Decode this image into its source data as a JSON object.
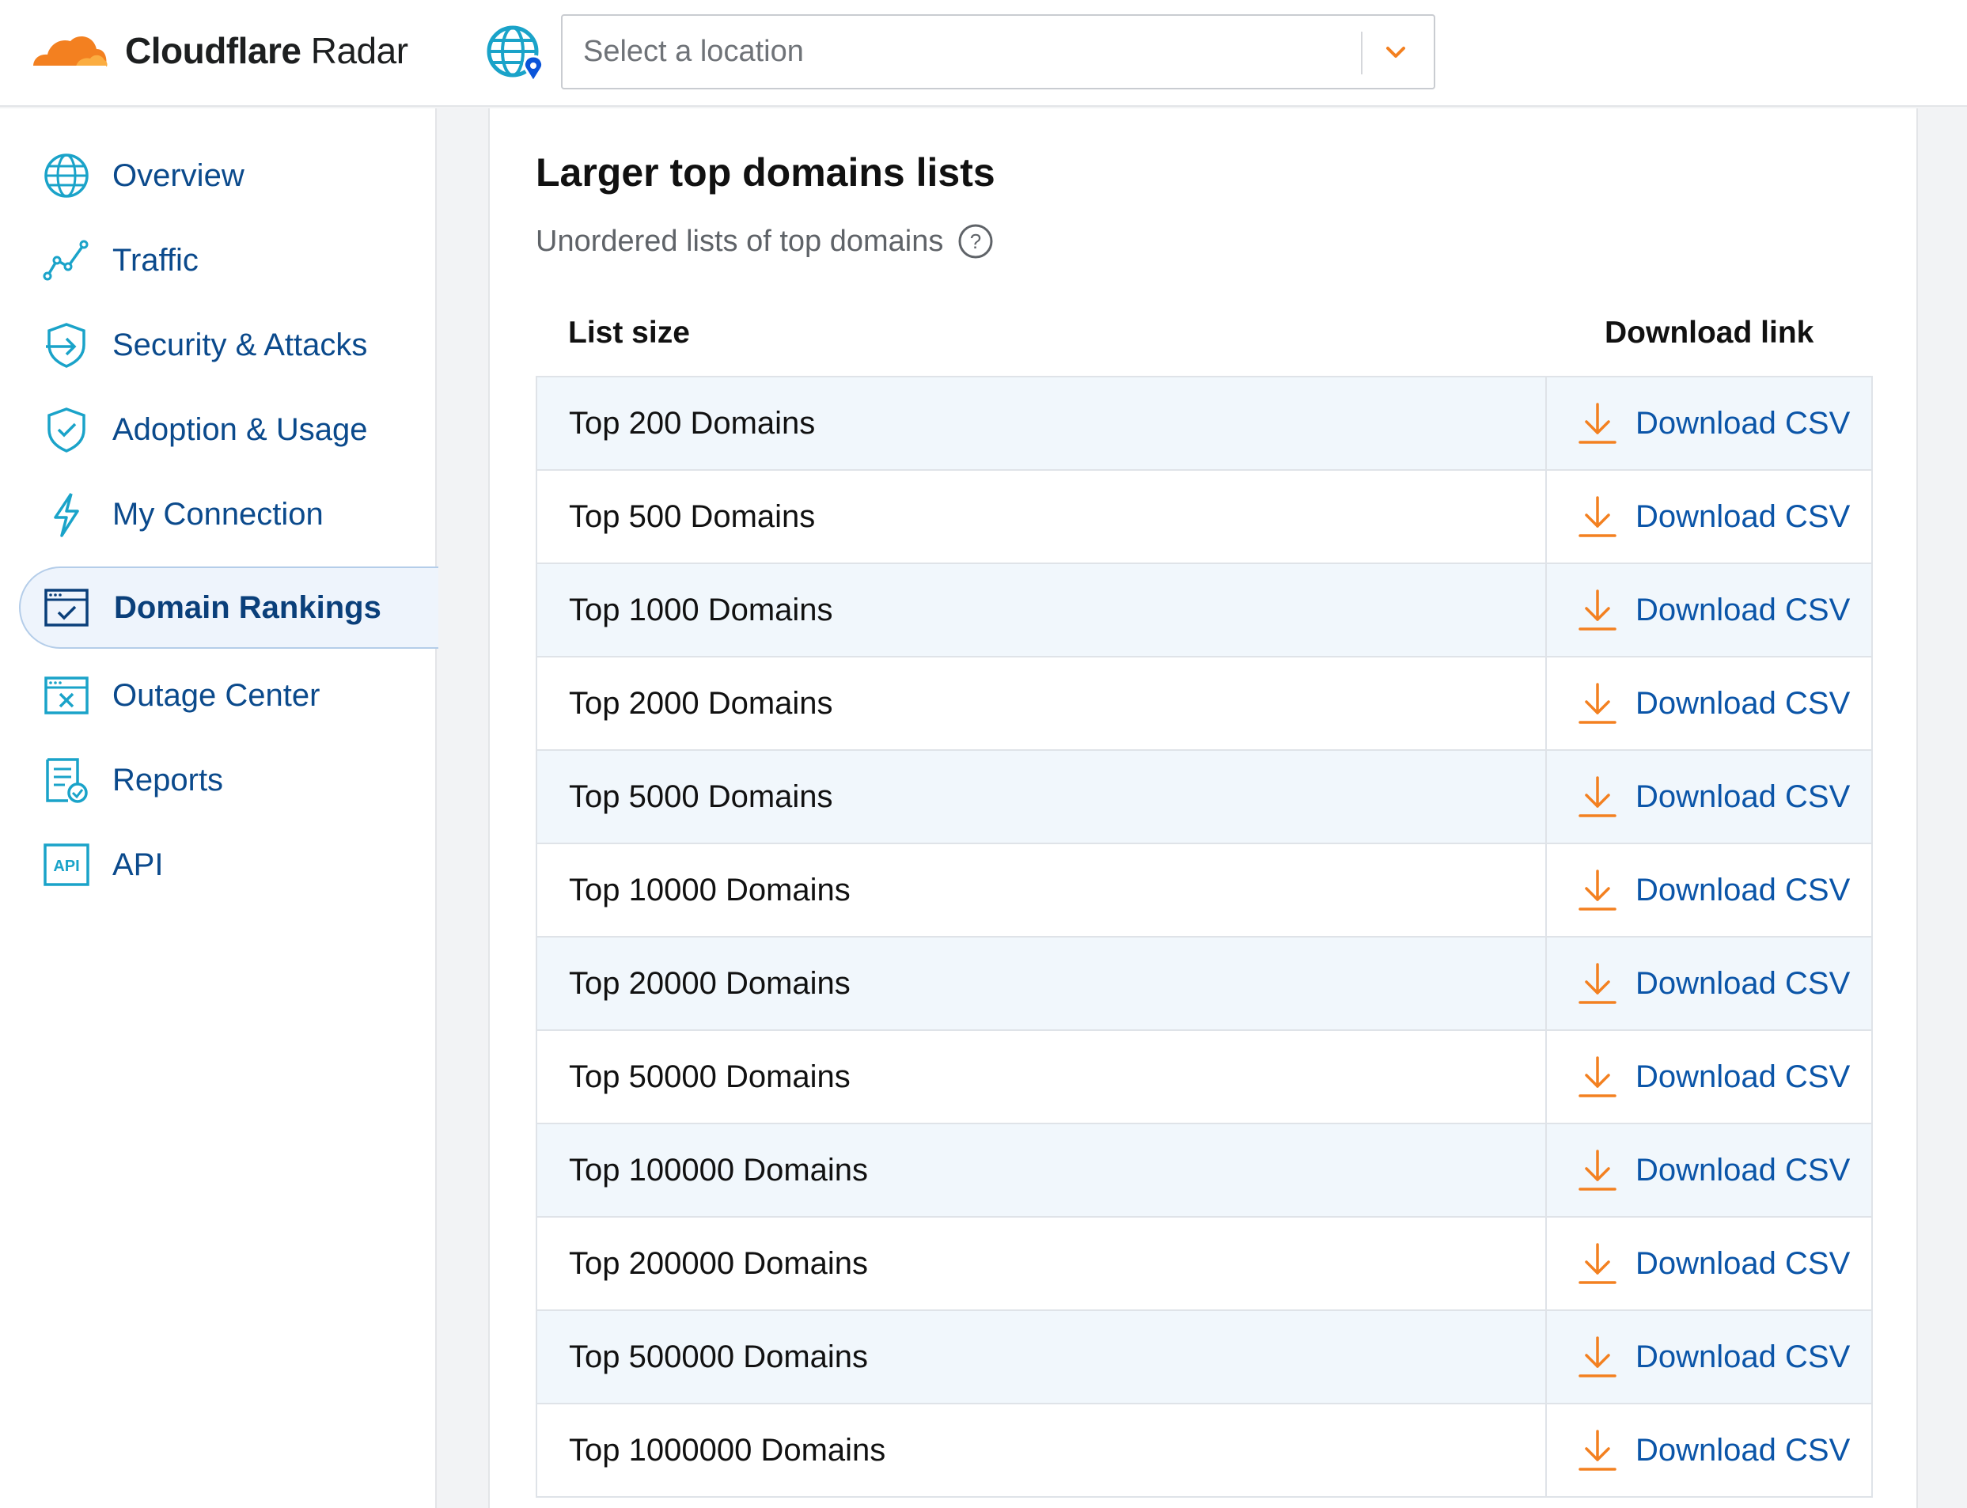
{
  "header": {
    "brand_bold": "Cloudflare",
    "brand_light": "Radar",
    "location_placeholder": "Select a location",
    "brand_color": "#f38020"
  },
  "sidebar": {
    "items": [
      {
        "label": "Overview",
        "icon": "globe-grid-icon"
      },
      {
        "label": "Traffic",
        "icon": "traffic-line-icon"
      },
      {
        "label": "Security & Attacks",
        "icon": "shield-arrow-icon"
      },
      {
        "label": "Adoption & Usage",
        "icon": "shield-check-icon"
      },
      {
        "label": "My Connection",
        "icon": "lightning-icon"
      },
      {
        "label": "Domain Rankings",
        "icon": "browser-check-icon",
        "active": true
      },
      {
        "label": "Outage Center",
        "icon": "browser-x-icon"
      },
      {
        "label": "Reports",
        "icon": "report-check-icon"
      },
      {
        "label": "API",
        "icon": "api-icon"
      }
    ]
  },
  "main": {
    "title": "Larger top domains lists",
    "subtitle": "Unordered lists of top domains",
    "columns": {
      "size": "List size",
      "download": "Download link"
    },
    "download_label": "Download CSV",
    "rows": [
      {
        "name": "Top 200 Domains",
        "link": "Download CSV"
      },
      {
        "name": "Top 500 Domains",
        "link": "Download CSV"
      },
      {
        "name": "Top 1000 Domains",
        "link": "Download CSV"
      },
      {
        "name": "Top 2000 Domains",
        "link": "Download CSV"
      },
      {
        "name": "Top 5000 Domains",
        "link": "Download CSV"
      },
      {
        "name": "Top 10000 Domains",
        "link": "Download CSV"
      },
      {
        "name": "Top 20000 Domains",
        "link": "Download CSV"
      },
      {
        "name": "Top 50000 Domains",
        "link": "Download CSV"
      },
      {
        "name": "Top 100000 Domains",
        "link": "Download CSV"
      },
      {
        "name": "Top 200000 Domains",
        "link": "Download CSV"
      },
      {
        "name": "Top 500000 Domains",
        "link": "Download CSV"
      },
      {
        "name": "Top 1000000 Domains",
        "link": "Download CSV"
      }
    ]
  },
  "colors": {
    "accent_orange": "#f38020",
    "link_blue": "#0b55a8",
    "icon_teal": "#1aa3c9",
    "row_alt": "#f1f7fc"
  }
}
